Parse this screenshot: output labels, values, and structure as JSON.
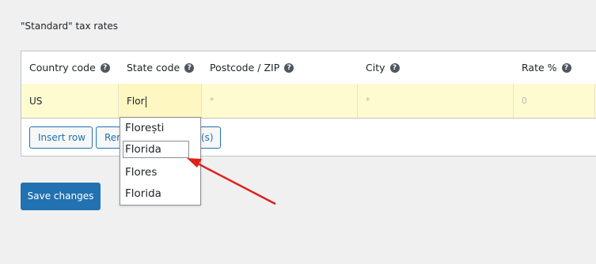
{
  "page": {
    "title": "\"Standard\" tax rates"
  },
  "table": {
    "columns": [
      {
        "label": "Country code"
      },
      {
        "label": "State code"
      },
      {
        "label": "Postcode / ZIP"
      },
      {
        "label": "City"
      },
      {
        "label": "Rate %"
      }
    ],
    "help_glyph": "?",
    "row": {
      "country": "US",
      "state": "Flor",
      "postcode_placeholder": "*",
      "city_placeholder": "*",
      "rate_placeholder": "0"
    }
  },
  "buttons": {
    "insert_row": "Insert row",
    "remove_row_partial": "Rem",
    "export_partial": "(s)",
    "save_changes": "Save changes"
  },
  "autocomplete": {
    "items": [
      "Florești",
      "Florida",
      "Flores",
      "Florida"
    ],
    "highlighted_index": 1
  },
  "annotation": {
    "arrow_color": "#e0201b"
  }
}
